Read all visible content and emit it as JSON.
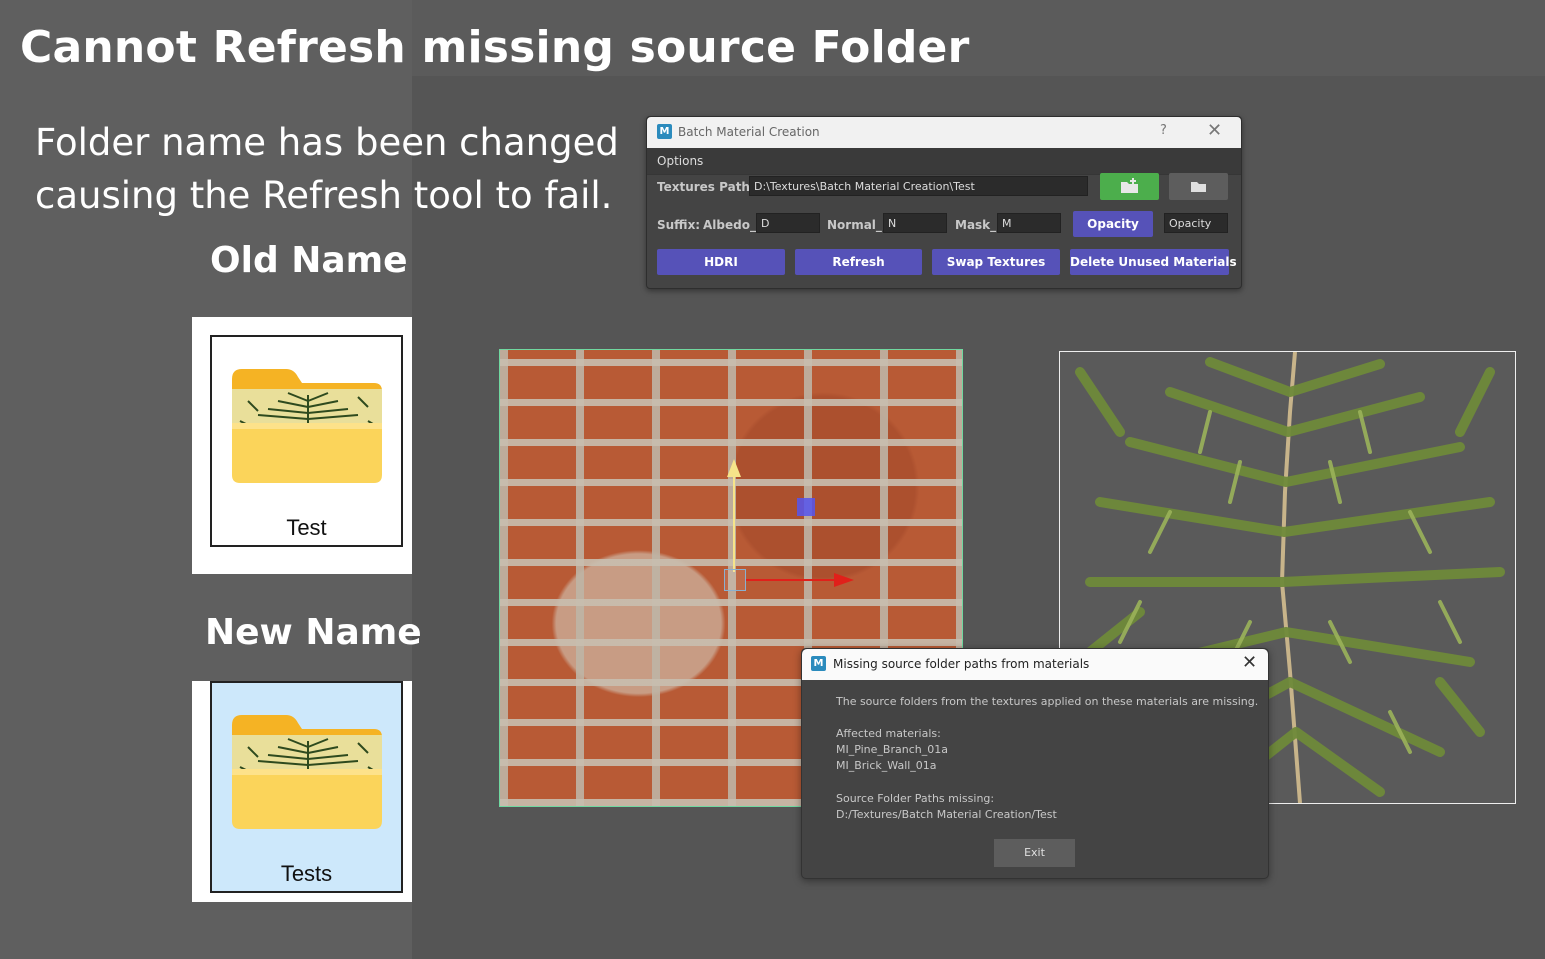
{
  "heading": "Cannot Refresh missing source Folder",
  "description_line1": "Folder name has been changed",
  "description_line2": "causing the Refresh tool to fail.",
  "old_label": "Old Name",
  "new_label": "New Name",
  "old_folder_name": "Test",
  "new_folder_name": "Tests",
  "batch_dialog": {
    "logo": "M",
    "title": "Batch Material Creation",
    "help": "?",
    "close": "✕",
    "menu_options": "Options",
    "textures_path_label": "Textures Path:",
    "textures_path_value": "D:\\Textures\\Batch Material Creation\\Test",
    "suffix_label": "Suffix:",
    "albedo_label": "Albedo_",
    "albedo_value": "D",
    "normal_label": "Normal_",
    "normal_value": "N",
    "mask_label": "Mask_",
    "mask_value": "M",
    "opacity_button": "Opacity",
    "opacity_value": "Opacity",
    "hdri_button": "HDRI",
    "refresh_button": "Refresh",
    "swap_button": "Swap Textures",
    "delete_button": "Delete Unused Materials"
  },
  "missing_dialog": {
    "logo": "M",
    "title": "Missing source folder paths from materials",
    "close": "✕",
    "message": "The source folders from the textures applied on these materials are missing.",
    "affected_label": "Affected materials:",
    "material_1": "MI_Pine_Branch_01a",
    "material_2": "MI_Brick_Wall_01a",
    "paths_label": "Source Folder Paths missing:",
    "path_1": "D:/Textures/Batch Material Creation/Test",
    "exit_button": "Exit"
  },
  "colors": {
    "accent_button": "#5652b8",
    "new_folder_button": "#4cae4c",
    "selected_folder_bg": "#cde8fb"
  }
}
